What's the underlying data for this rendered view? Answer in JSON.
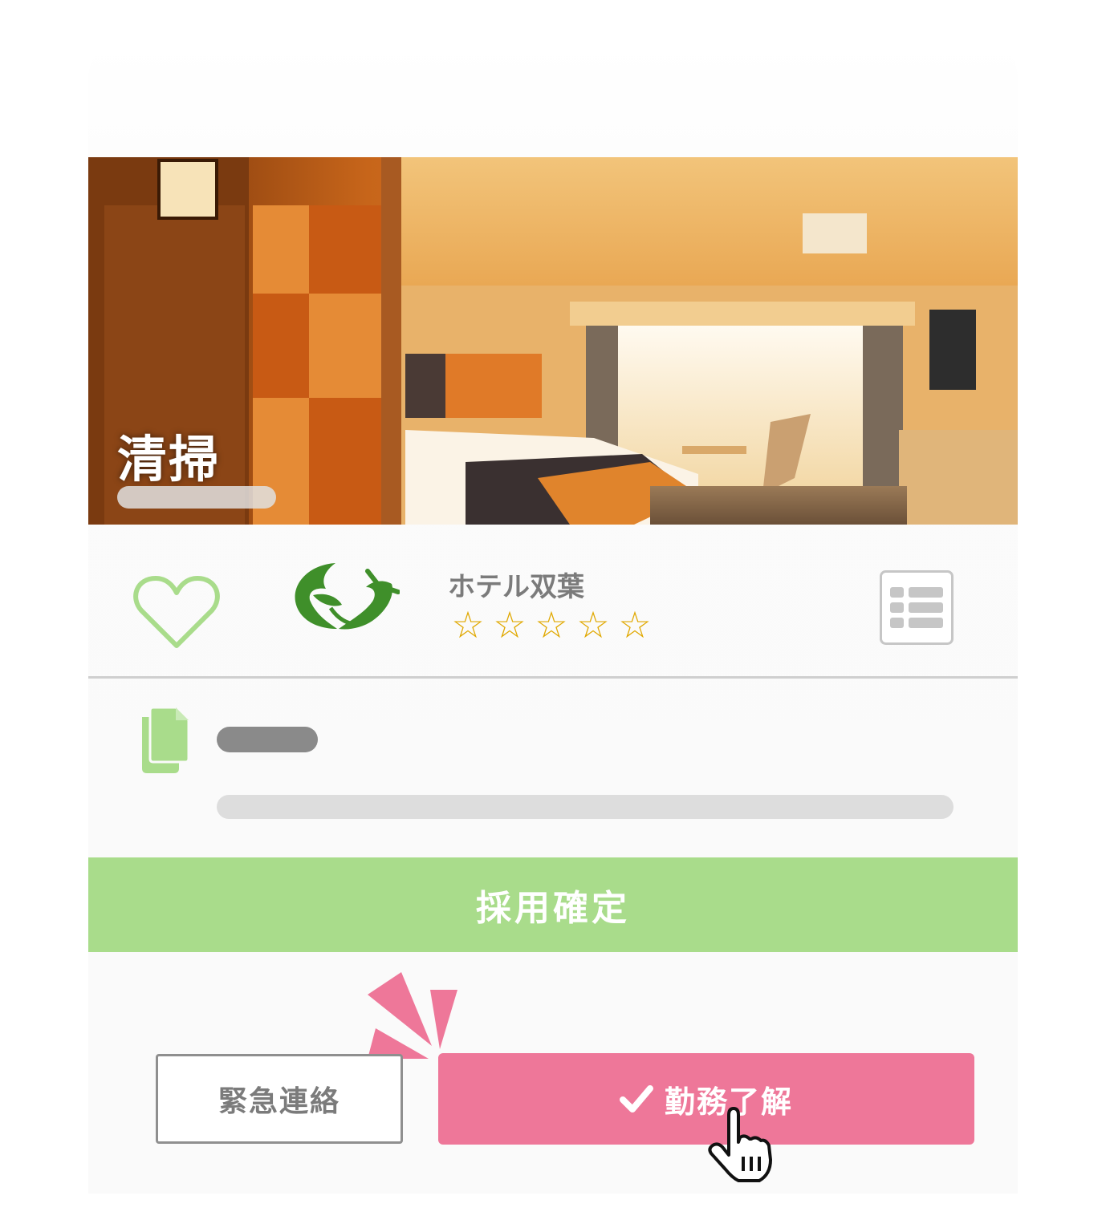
{
  "hero": {
    "title": "清掃"
  },
  "hotel": {
    "name": "ホテル双葉",
    "rating_stars": [
      "☆",
      "☆",
      "☆",
      "☆",
      "☆"
    ]
  },
  "actions": {
    "confirm_label": "採用確定",
    "emergency_label": "緊急連絡",
    "acknowledge_label": "勤務了解",
    "acknowledge_icon": "check-icon"
  },
  "icons": {
    "favorite": "heart-icon",
    "hotel_logo": "hotel-logo",
    "menu": "list-icon",
    "document": "documents-icon",
    "pointer": "hand-pointer-icon"
  },
  "colors": {
    "accent_green": "#a9dc8b",
    "accent_pink": "#ee7799",
    "star": "#e0a800",
    "logo_green": "#3f8f2a"
  }
}
